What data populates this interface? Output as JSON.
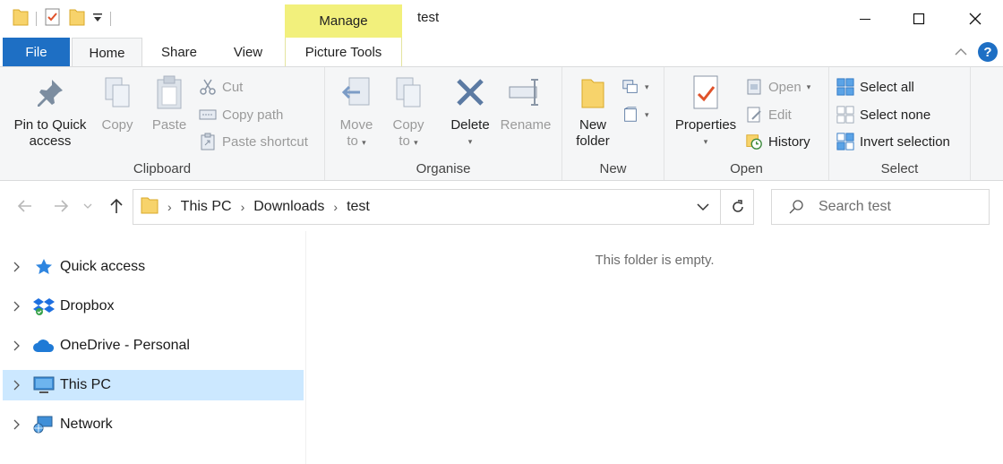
{
  "title_bar": {
    "context_tab": "Manage",
    "window_title": "test",
    "qat_icons": [
      "folder-icon",
      "properties-icon",
      "new-folder-icon",
      "customize-qat-icon"
    ],
    "controls": [
      "minimize-icon",
      "maximize-icon",
      "close-icon"
    ]
  },
  "tabs": {
    "file": "File",
    "home": "Home",
    "share": "Share",
    "view": "View",
    "picture_tools": "Picture Tools"
  },
  "ribbon": {
    "clipboard": {
      "label": "Clipboard",
      "pin": [
        "Pin to Quick",
        "access"
      ],
      "copy": "Copy",
      "paste": "Paste",
      "cut": "Cut",
      "copy_path": "Copy path",
      "paste_shortcut": "Paste shortcut"
    },
    "organise": {
      "label": "Organise",
      "move_to": [
        "Move",
        "to"
      ],
      "copy_to": [
        "Copy",
        "to"
      ],
      "delete": "Delete",
      "rename": "Rename"
    },
    "new": {
      "label": "New",
      "new_folder": [
        "New",
        "folder"
      ]
    },
    "open": {
      "label": "Open",
      "properties": "Properties",
      "open": "Open",
      "edit": "Edit",
      "history": "History"
    },
    "select": {
      "label": "Select",
      "select_all": "Select all",
      "select_none": "Select none",
      "invert_selection": "Invert selection"
    }
  },
  "address": {
    "crumbs": [
      "This PC",
      "Downloads",
      "test"
    ],
    "search_placeholder": "Search test"
  },
  "nav_pane": {
    "items": [
      {
        "label": "Quick access",
        "icon": "star-icon",
        "selected": false
      },
      {
        "label": "Dropbox",
        "icon": "dropbox-icon",
        "selected": false
      },
      {
        "label": "OneDrive - Personal",
        "icon": "onedrive-icon",
        "selected": false
      },
      {
        "label": "This PC",
        "icon": "computer-icon",
        "selected": true
      },
      {
        "label": "Network",
        "icon": "network-icon",
        "selected": false
      }
    ]
  },
  "content": {
    "empty_message": "This folder is empty."
  },
  "colors": {
    "accent": "#1e6fc4",
    "context_tab": "#f2f07c",
    "selection": "#cce8ff",
    "ribbon_bg": "#f5f6f7"
  }
}
